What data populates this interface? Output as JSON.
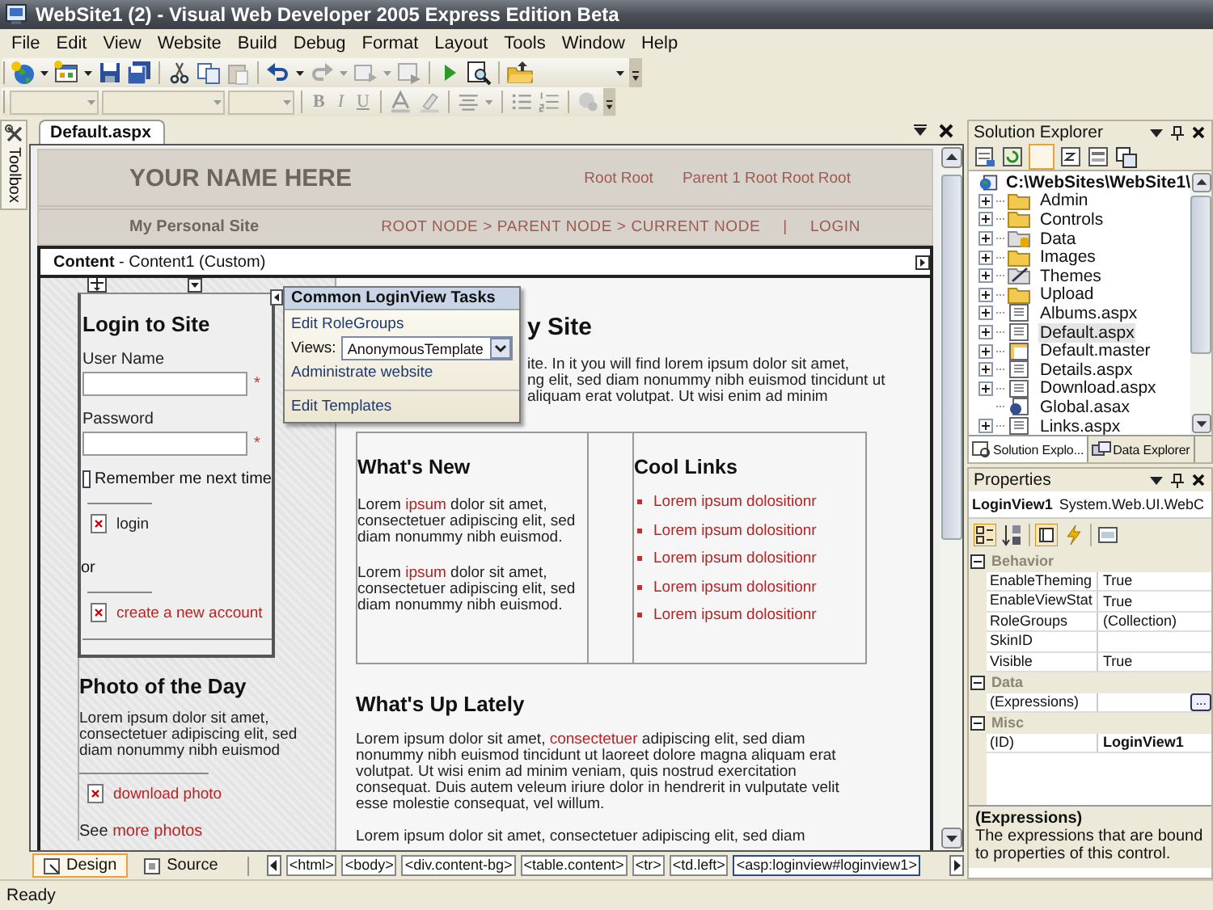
{
  "window": {
    "title": "WebSite1 (2) - Visual Web Developer 2005 Express Edition Beta"
  },
  "menu": [
    "File",
    "Edit",
    "View",
    "Website",
    "Build",
    "Debug",
    "Format",
    "Layout",
    "Tools",
    "Window",
    "Help"
  ],
  "format_buttons": [
    {
      "label": "B",
      "kind": "bold",
      "disabled": true
    },
    {
      "label": "I",
      "kind": "italic",
      "disabled": true
    },
    {
      "label": "U",
      "kind": "underline",
      "disabled": true
    }
  ],
  "toolbox_tab": {
    "label": "Toolbox"
  },
  "document_tabs": [
    {
      "label": "Default.aspx",
      "selected": true
    }
  ],
  "master_header": {
    "site_title": "YOUR NAME HERE",
    "top_links": [
      "Root Root",
      "Parent 1 Root Root Root"
    ],
    "subtitle": "My Personal Site",
    "breadcrumb": "ROOT NODE > PARENT NODE > CURRENT NODE",
    "separator": "|",
    "login_link": "LOGIN"
  },
  "content_region": {
    "label": "**Content** - Content1 (Custom)"
  },
  "login_box": {
    "heading": "Login to Site",
    "fields": [
      {
        "label": "User Name",
        "required_mark": "*"
      },
      {
        "label": "Password",
        "required_mark": "*"
      }
    ],
    "remember": {
      "label": "Remember me next time",
      "checked": false
    },
    "login_link": "login",
    "or_text": "or",
    "create_link": "create a new account"
  },
  "photo_box": {
    "heading": "Photo of the Day",
    "text": "Lorem ipsum dolor sit amet, consectetuer adipiscing elit, sed diam nonummy nibh euismod",
    "download_link": "download photo",
    "more_prefix": "See",
    "more_link": "more photos"
  },
  "smart_tag": {
    "title": "Common LoginView Tasks",
    "items": [
      {
        "kind": "link",
        "text": "Edit RoleGroups"
      },
      {
        "kind": "select",
        "label": "Views:",
        "value": "AnonymousTemplate"
      },
      {
        "kind": "link",
        "text": "Administrate website"
      },
      {
        "kind": "divider"
      },
      {
        "kind": "link",
        "text": "Edit Templates"
      }
    ]
  },
  "welcome": {
    "heading_fragment": "y Site",
    "text_fragments": [
      "ite. In it you will find lorem ipsum dolor sit amet,",
      "ng elit, sed diam nonummy nibh euismod tincidunt ut",
      "aliquam erat volutpat. Ut wisi enim ad minim"
    ]
  },
  "whats_new": {
    "heading": "What's New",
    "paragraphs": [
      {
        "before": "Lorem",
        "link": "ipsum",
        "after": "dolor sit amet, consectetuer adipiscing elit, sed diam nonummy nibh euismod."
      },
      {
        "before": "Lorem",
        "link": "ipsum",
        "after": "dolor sit amet, consectetuer adipiscing elit, sed diam nonummy nibh euismod."
      }
    ]
  },
  "cool_links": {
    "heading": "Cool Links",
    "items": [
      "Lorem ipsum dolositionr",
      "Lorem ipsum dolositionr",
      "Lorem ipsum dolositionr",
      "Lorem ipsum dolositionr",
      "Lorem ipsum dolositionr"
    ]
  },
  "whats_up": {
    "heading": "What's Up Lately",
    "paragraphs": [
      {
        "before": "Lorem ipsum dolor sit amet,",
        "link": "consectetuer",
        "after": "adipiscing elit, sed diam nonummy nibh euismod tincidunt ut laoreet dolore magna aliquam erat volutpat. Ut wisi enim ad minim veniam, quis nostrud exercitation consequat. Duis autem veleum iriure dolor in hendrerit in vulputate velit esse molestie consequat, vel willum."
      },
      {
        "before": "Lorem ipsum dolor sit amet, consectetuer adipiscing elit, sed diam"
      }
    ]
  },
  "view_tabs": [
    {
      "label": "Design",
      "selected": true
    },
    {
      "label": "Source",
      "selected": false
    }
  ],
  "tag_path": [
    {
      "label": "<html>",
      "selected": false
    },
    {
      "label": "<body>",
      "selected": false
    },
    {
      "label": "<div.content-bg>",
      "selected": false
    },
    {
      "label": "<table.content>",
      "selected": false
    },
    {
      "label": "<tr>",
      "selected": false
    },
    {
      "label": "<td.left>",
      "selected": false
    },
    {
      "label": "<asp:loginview#loginview1>",
      "selected": true
    }
  ],
  "solution_explorer": {
    "title": "Solution Explorer",
    "tree": {
      "label": "C:\\WebSites\\WebSite1\\",
      "children": [
        {
          "label": "Admin",
          "kind": "folder",
          "expandable": true,
          "selected": false
        },
        {
          "label": "Controls",
          "kind": "folder",
          "expandable": true,
          "selected": false
        },
        {
          "label": "Data",
          "kind": "data-folder",
          "expandable": true,
          "selected": false
        },
        {
          "label": "Images",
          "kind": "folder",
          "expandable": true,
          "selected": false
        },
        {
          "label": "Themes",
          "kind": "theme-folder",
          "expandable": true,
          "selected": false
        },
        {
          "label": "Upload",
          "kind": "folder",
          "expandable": true,
          "selected": false
        },
        {
          "label": "Albums.aspx",
          "kind": "page",
          "expandable": true,
          "selected": false
        },
        {
          "label": "Default.aspx",
          "kind": "page",
          "expandable": true,
          "selected": true
        },
        {
          "label": "Default.master",
          "kind": "master",
          "expandable": true,
          "selected": false
        },
        {
          "label": "Details.aspx",
          "kind": "page",
          "expandable": true,
          "selected": false
        },
        {
          "label": "Download.aspx",
          "kind": "page",
          "expandable": true,
          "selected": false
        },
        {
          "label": "Global.asax",
          "kind": "asax",
          "expandable": false,
          "selected": false
        },
        {
          "label": "Links.aspx",
          "kind": "page",
          "expandable": true,
          "selected": false
        }
      ]
    },
    "tabs": [
      {
        "label": "Solution Explo...",
        "selected": true
      },
      {
        "label": "Data Explorer",
        "selected": false
      }
    ]
  },
  "properties": {
    "title": "Properties",
    "object_name": "LoginView1",
    "object_type": "System.Web.UI.WebC",
    "categories": [
      {
        "name": "Behavior",
        "expanded": true,
        "rows": [
          {
            "name": "EnableTheming",
            "value": "True",
            "modified": false
          },
          {
            "name": "EnableViewStat",
            "value": "True",
            "modified": false
          },
          {
            "name": "RoleGroups",
            "value": "(Collection)",
            "modified": false
          },
          {
            "name": "SkinID",
            "modified": false
          },
          {
            "name": "Visible",
            "value": "True",
            "modified": false
          }
        ]
      },
      {
        "name": "Data",
        "expanded": true,
        "rows": [
          {
            "name": "(Expressions)",
            "button": "...",
            "modified": false
          }
        ]
      },
      {
        "name": "Misc",
        "expanded": true,
        "rows": [
          {
            "name": "(ID)",
            "value": "LoginView1",
            "modified": true
          }
        ]
      }
    ],
    "description": {
      "title": "(Expressions)",
      "text": "The expressions that are bound to properties of this control."
    }
  },
  "status_bar": {
    "text": "Ready"
  }
}
